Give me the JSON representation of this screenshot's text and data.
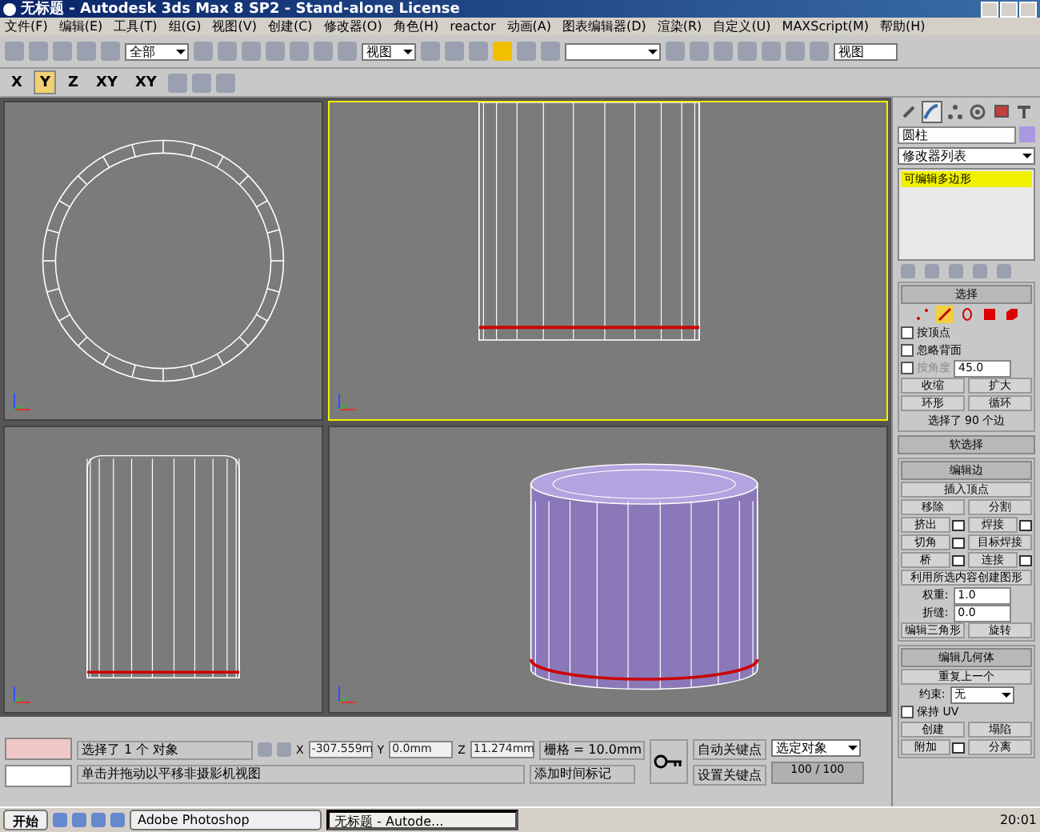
{
  "window": {
    "title": "无标题 - Autodesk 3ds Max 8 SP2  - Stand-alone License"
  },
  "menu": [
    "文件(F)",
    "编辑(E)",
    "工具(T)",
    "组(G)",
    "视图(V)",
    "创建(C)",
    "修改器(O)",
    "角色(H)",
    "reactor",
    "动画(A)",
    "图表编辑器(D)",
    "渲染(R)",
    "自定义(U)",
    "MAXScript(M)",
    "帮助(H)"
  ],
  "toolbar": {
    "selection_filter": "全部",
    "ref_coord": "视图",
    "view_dropdown": "视图"
  },
  "axis_buttons": [
    {
      "label": "X",
      "selected": false
    },
    {
      "label": "Y",
      "selected": true
    },
    {
      "label": "Z",
      "selected": false
    },
    {
      "label": "XY",
      "selected": false
    },
    {
      "label": "XY",
      "selected": false
    }
  ],
  "viewports": [
    {
      "kind": "top",
      "active": false
    },
    {
      "kind": "front",
      "active": true
    },
    {
      "kind": "left",
      "active": false
    },
    {
      "kind": "perspective",
      "active": false
    }
  ],
  "command_panel": {
    "tabs": [
      {
        "kind": "create",
        "selected": false
      },
      {
        "kind": "modify",
        "selected": true
      },
      {
        "kind": "hierarchy",
        "selected": false
      },
      {
        "kind": "motion",
        "selected": false
      },
      {
        "kind": "display",
        "selected": false
      },
      {
        "kind": "utilities",
        "selected": false
      }
    ],
    "object_name": "圆柱",
    "modifier_list": "修改器列表",
    "stack": [
      {
        "label": "可编辑多边形",
        "selected": true
      }
    ],
    "selection": {
      "title": "选择",
      "subobjects": [
        {
          "kind": "vertex",
          "selected": false
        },
        {
          "kind": "edge",
          "selected": true
        },
        {
          "kind": "border",
          "selected": false
        },
        {
          "kind": "polygon",
          "selected": false
        },
        {
          "kind": "element",
          "selected": false
        }
      ],
      "options": [
        {
          "label": "按顶点",
          "checked": false,
          "disabled": false
        },
        {
          "label": "忽略背面",
          "checked": false,
          "disabled": false
        },
        {
          "label": "按角度",
          "checked": false,
          "disabled": true
        }
      ],
      "angle": "45.0",
      "buttons": [
        [
          "收缩",
          "扩大"
        ],
        [
          "环形",
          "循环"
        ]
      ],
      "info": "选择了 90 个边"
    },
    "collapsed_rollouts": [
      "软选择"
    ],
    "edit_edges": {
      "title": "编辑边",
      "insert": "插入顶点",
      "pairs": [
        [
          {
            "label": "移除",
            "settings": false
          },
          {
            "label": "分割",
            "settings": false
          }
        ],
        [
          {
            "label": "挤出",
            "settings": true
          },
          {
            "label": "焊接",
            "settings": true
          }
        ],
        [
          {
            "label": "切角",
            "settings": true
          },
          {
            "label": "目标焊接",
            "settings": false
          }
        ],
        [
          {
            "label": "桥",
            "settings": true
          },
          {
            "label": "连接",
            "settings": true
          }
        ]
      ],
      "create_shape": "利用所选内容创建图形",
      "spinners": [
        {
          "label": "权重:",
          "value": "1.0"
        },
        {
          "label": "折缝:",
          "value": "0.0"
        }
      ],
      "bottom": [
        "编辑三角形",
        "旋转"
      ]
    },
    "edit_geometry": {
      "title": "编辑几何体",
      "repeat": "重复上一个",
      "constraint_label": "约束:",
      "constraint": "无",
      "preserve_uv": {
        "label": "保持 UV",
        "checked": false
      },
      "pairs": [
        [
          {
            "label": "创建",
            "settings": false
          },
          {
            "label": "塌陷",
            "settings": false
          }
        ],
        [
          {
            "label": "附加",
            "settings": true
          },
          {
            "label": "分离",
            "settings": false
          }
        ]
      ]
    }
  },
  "status": {
    "selected": "选择了 1 个 对象",
    "prompt": "单击并拖动以平移非摄影机视图",
    "coords": [
      {
        "axis": "X",
        "value": "-307.559m"
      },
      {
        "axis": "Y",
        "value": "0.0mm"
      },
      {
        "axis": "Z",
        "value": "11.274mm"
      }
    ],
    "grid": "栅格 = 10.0mm",
    "time_tag": "添加时间标记",
    "auto_key": "自动关键点",
    "set_key": "设置关键点",
    "key_target": "选定对象",
    "time": "100 / 100"
  },
  "taskbar": {
    "start": "开始",
    "tasks": [
      {
        "label": "Adobe Photoshop",
        "selected": false
      },
      {
        "label": "无标题 - Autode...",
        "selected": true
      }
    ],
    "clock": "20:01"
  }
}
